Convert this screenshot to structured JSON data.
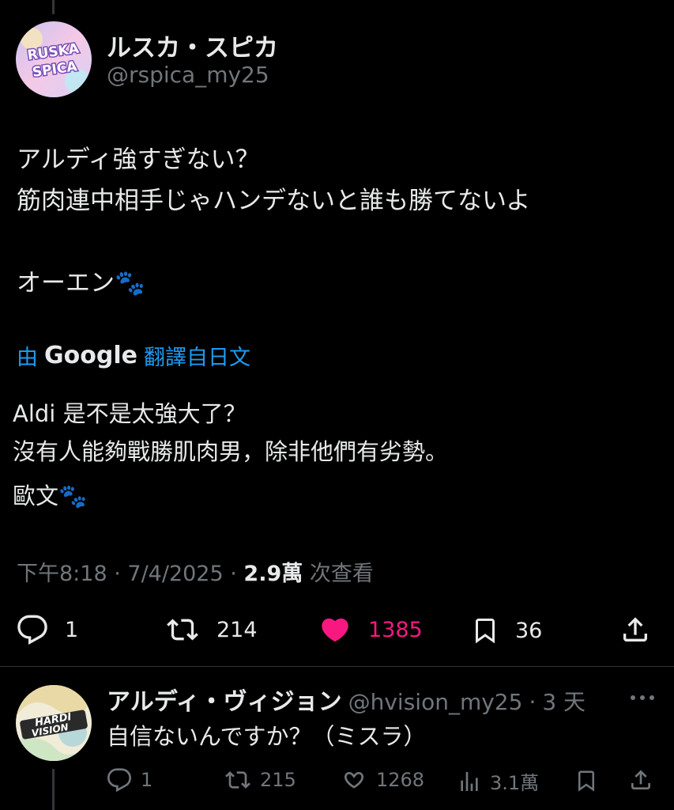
{
  "tweet": {
    "display_name": "ルスカ・スピカ",
    "handle": "@rspica_my25",
    "avatar_text": [
      "RUSKA",
      "SPICA"
    ],
    "text_lines": [
      "アルディ強すぎない？",
      "筋肉連中相手じゃハンデないと誰も勝てないよ",
      "",
      "オーエン🐾"
    ],
    "translation": {
      "prefix": "由",
      "provider": "Google",
      "suffix": "翻譯自日文",
      "lines": [
        "Aldi 是不是太強大了？",
        "沒有人能夠戰勝肌肉男，除非他們有劣勢。"
      ],
      "last_line": "歐文🐾"
    },
    "meta": {
      "time": "下午8:18",
      "sep1": " · ",
      "date": "7/4/2025",
      "sep2": " · ",
      "views": "2.9萬",
      "views_suffix": " 次查看"
    },
    "actions": {
      "reply_count": "1",
      "retweet_count": "214",
      "like_count": "1385",
      "bookmark_count": "36"
    }
  },
  "reply": {
    "display_name": "アルディ・ヴィジョン",
    "handle": "@hvision_my25",
    "sep": "·",
    "time": "3 天",
    "avatar_text": [
      "HARDI",
      "VISION"
    ],
    "text": "自信ないんですか？（ミスラ）",
    "actions": {
      "reply_count": "1",
      "retweet_count": "215",
      "like_count": "1268",
      "views_count": "3.1萬"
    }
  },
  "colors": {
    "background": "#000000",
    "text": "#e7e9ea",
    "muted": "#71767b",
    "link": "#1d9bf0",
    "like": "#f91880"
  }
}
